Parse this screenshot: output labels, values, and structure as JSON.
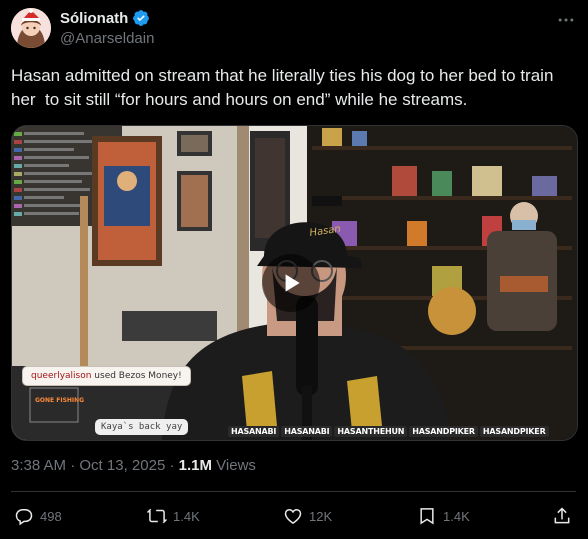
{
  "author": {
    "display_name": "Sólionath",
    "handle": "@Anarseldain",
    "verified": true
  },
  "tweet": {
    "text": "Hasan admitted on stream that he literally ties his dog to her bed to train her  to sit still “for hours and hours on end” while he streams."
  },
  "media": {
    "type": "video",
    "overlays": {
      "chat_user": "queerlyalison",
      "chat_action": " used Bezos Money!",
      "kaya_label": "Kaya`s back yay",
      "gone_fishing": "GONE FISHING",
      "cap_text": "Hasan",
      "socials": [
        "HASANABI",
        "HASANABI",
        "HASANTHEHUN",
        "HASANDPIKER",
        "HASANDPIKER"
      ]
    }
  },
  "meta": {
    "time": "3:38 AM",
    "separator": " · ",
    "date": "Oct 13, 2025",
    "views_count": "1.1M",
    "views_label": " Views"
  },
  "actions": {
    "replies": "498",
    "reposts": "1.4K",
    "likes": "12K",
    "bookmarks": "1.4K"
  },
  "colors": {
    "background": "#000000",
    "text": "#e7e9ea",
    "muted": "#71767b",
    "verified": "#1d9bf0",
    "border": "#2f3336"
  },
  "icons": [
    "more-icon",
    "verified-icon",
    "play-icon",
    "reply-icon",
    "repost-icon",
    "like-icon",
    "bookmark-icon",
    "share-icon"
  ]
}
